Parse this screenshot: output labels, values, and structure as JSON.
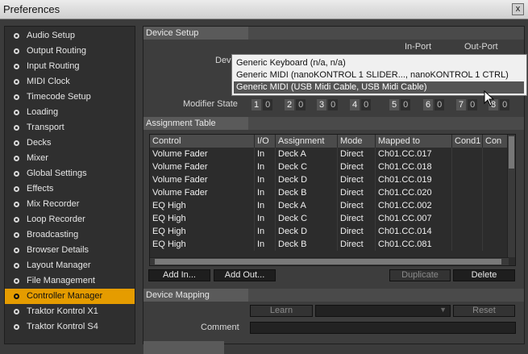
{
  "window": {
    "title": "Preferences",
    "close_label": "x"
  },
  "sidebar": {
    "items": [
      {
        "label": "Audio Setup",
        "active": false
      },
      {
        "label": "Output Routing",
        "active": false
      },
      {
        "label": "Input Routing",
        "active": false
      },
      {
        "label": "MIDI Clock",
        "active": false
      },
      {
        "label": "Timecode Setup",
        "active": false
      },
      {
        "label": "Loading",
        "active": false
      },
      {
        "label": "Transport",
        "active": false
      },
      {
        "label": "Decks",
        "active": false
      },
      {
        "label": "Mixer",
        "active": false
      },
      {
        "label": "Global Settings",
        "active": false
      },
      {
        "label": "Effects",
        "active": false
      },
      {
        "label": "Mix Recorder",
        "active": false
      },
      {
        "label": "Loop Recorder",
        "active": false
      },
      {
        "label": "Broadcasting",
        "active": false
      },
      {
        "label": "Browser Details",
        "active": false
      },
      {
        "label": "Layout Manager",
        "active": false
      },
      {
        "label": "File Management",
        "active": false
      },
      {
        "label": "Controller Manager",
        "active": true
      },
      {
        "label": "Traktor Kontrol X1",
        "active": false
      },
      {
        "label": "Traktor Kontrol S4",
        "active": false
      }
    ]
  },
  "device_setup": {
    "header": "Device Setup",
    "in_port_label": "In-Port",
    "out_port_label": "Out-Port",
    "device_label": "Dev",
    "modifier_label": "Modifier State",
    "modifiers": [
      {
        "num": "1",
        "val": "0"
      },
      {
        "num": "2",
        "val": "0"
      },
      {
        "num": "3",
        "val": "0"
      },
      {
        "num": "4",
        "val": "0"
      },
      {
        "num": "5",
        "val": "0"
      },
      {
        "num": "6",
        "val": "0"
      },
      {
        "num": "7",
        "val": "0"
      },
      {
        "num": "8",
        "val": "0"
      }
    ]
  },
  "dropdown": {
    "options": [
      {
        "label": "Generic Keyboard (n/a, n/a)",
        "selected": false
      },
      {
        "label": "Generic MIDI (nanoKONTROL 1 SLIDER..., nanoKONTROL 1 CTRL)",
        "selected": false
      },
      {
        "label": "Generic MIDI (USB Midi Cable, USB Midi Cable)",
        "selected": true
      }
    ]
  },
  "assignment_table": {
    "header": "Assignment Table",
    "columns": [
      "Control",
      "I/O",
      "Assignment",
      "Mode",
      "Mapped to",
      "Cond1",
      "Con"
    ],
    "rows": [
      [
        "Volume Fader",
        "In",
        "Deck A",
        "Direct",
        "Ch01.CC.017",
        "",
        ""
      ],
      [
        "Volume Fader",
        "In",
        "Deck C",
        "Direct",
        "Ch01.CC.018",
        "",
        ""
      ],
      [
        "Volume Fader",
        "In",
        "Deck D",
        "Direct",
        "Ch01.CC.019",
        "",
        ""
      ],
      [
        "Volume Fader",
        "In",
        "Deck B",
        "Direct",
        "Ch01.CC.020",
        "",
        ""
      ],
      [
        "EQ High",
        "In",
        "Deck A",
        "Direct",
        "Ch01.CC.002",
        "",
        ""
      ],
      [
        "EQ High",
        "In",
        "Deck C",
        "Direct",
        "Ch01.CC.007",
        "",
        ""
      ],
      [
        "EQ High",
        "In",
        "Deck D",
        "Direct",
        "Ch01.CC.014",
        "",
        ""
      ],
      [
        "EQ High",
        "In",
        "Deck B",
        "Direct",
        "Ch01.CC.081",
        "",
        ""
      ]
    ],
    "buttons": {
      "add_in": "Add In...",
      "add_out": "Add Out...",
      "duplicate": "Duplicate",
      "delete": "Delete"
    }
  },
  "device_mapping": {
    "header": "Device Mapping",
    "learn_label": "Learn",
    "reset_label": "Reset",
    "comment_label": "Comment",
    "comment_value": ""
  }
}
